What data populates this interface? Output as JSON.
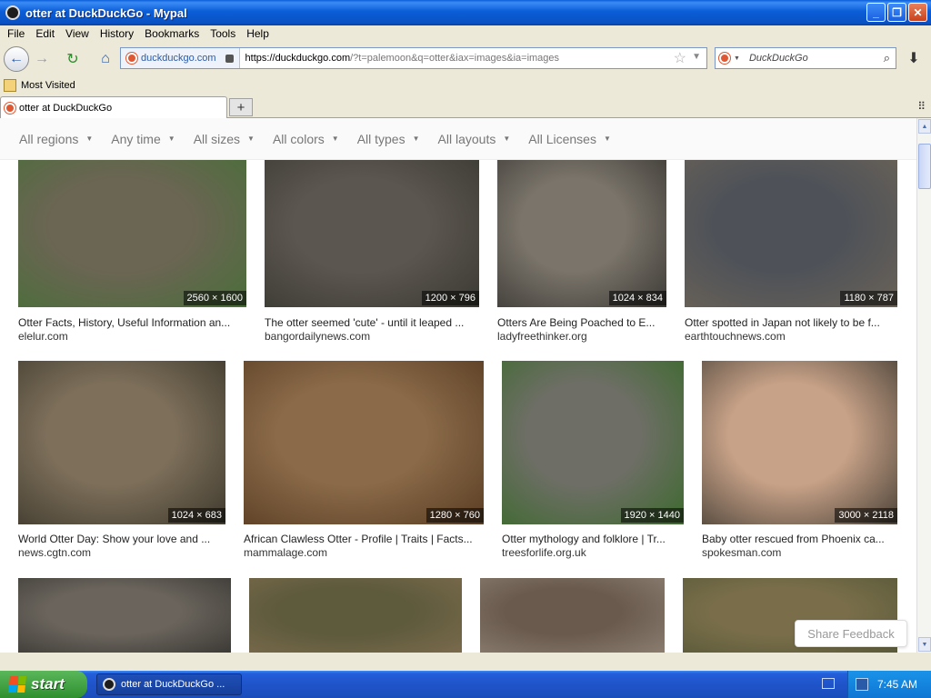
{
  "window": {
    "title": "otter at DuckDuckGo - Mypal"
  },
  "menu": [
    "File",
    "Edit",
    "View",
    "History",
    "Bookmarks",
    "Tools",
    "Help"
  ],
  "navbar": {
    "site_identity": "duckduckgo.com",
    "url_host": "https://duckduckgo.com",
    "url_rest": "/?t=palemoon&q=otter&iax=images&ia=images",
    "search_placeholder": "DuckDuckGo"
  },
  "bookmarks": {
    "most_visited": "Most Visited"
  },
  "tab": {
    "title": "otter at DuckDuckGo"
  },
  "filters": [
    "All regions",
    "Any time",
    "All sizes",
    "All colors",
    "All types",
    "All layouts",
    "All Licenses"
  ],
  "results": [
    {
      "caption": "Otter Facts, History, Useful Information an...",
      "source": "elelur.com",
      "dims": "2560 × 1600",
      "color": "#6b6553",
      "accent": "#4a6e3a"
    },
    {
      "caption": "The otter seemed 'cute' - until it leaped ...",
      "source": "bangordailynews.com",
      "dims": "1200 × 796",
      "color": "#5c5650",
      "accent": "#3a3a32"
    },
    {
      "caption": "Otters Are Being Poached to E...",
      "source": "ladyfreethinker.org",
      "dims": "1024 × 834",
      "color": "#7a746a",
      "accent": "#3d3a36"
    },
    {
      "caption": "Otter spotted in Japan not likely to be f...",
      "source": "earthtouchnews.com",
      "dims": "1180 × 787",
      "color": "#4e5258",
      "accent": "#6a6257"
    },
    {
      "caption": "World Otter Day: Show your love and ...",
      "source": "news.cgtn.com",
      "dims": "1024 × 683",
      "color": "#7d6f5a",
      "accent": "#3f3a2e"
    },
    {
      "caption": "African Clawless Otter - Profile | Traits | Facts...",
      "source": "mammalage.com",
      "dims": "1280 × 760",
      "color": "#8a6a48",
      "accent": "#5a3d24"
    },
    {
      "caption": "Otter mythology and folklore | Tr...",
      "source": "treesforlife.org.uk",
      "dims": "1920 × 1440",
      "color": "#6e6e66",
      "accent": "#3d6a2e"
    },
    {
      "caption": "Baby otter rescued from Phoenix ca...",
      "source": "spokesman.com",
      "dims": "3000 × 2118",
      "color": "#c8a288",
      "accent": "#4a4238"
    },
    {
      "color": "#6a645c",
      "accent": "#3c3a36"
    },
    {
      "color": "#5e5a3c",
      "accent": "#7a6a4c"
    },
    {
      "color": "#6a5a4e",
      "accent": "#8a7d70"
    },
    {
      "color": "#7a6e4a",
      "accent": "#5a5a3a"
    }
  ],
  "share_feedback": "Share Feedback",
  "taskbar": {
    "start": "start",
    "task": "otter at DuckDuckGo ...",
    "clock": "7:45 AM"
  },
  "colors": {
    "titlebar": "#0a5ed8",
    "taskbar": "#245edb",
    "start": "#3c9a3c",
    "ddg": "#de5833"
  }
}
